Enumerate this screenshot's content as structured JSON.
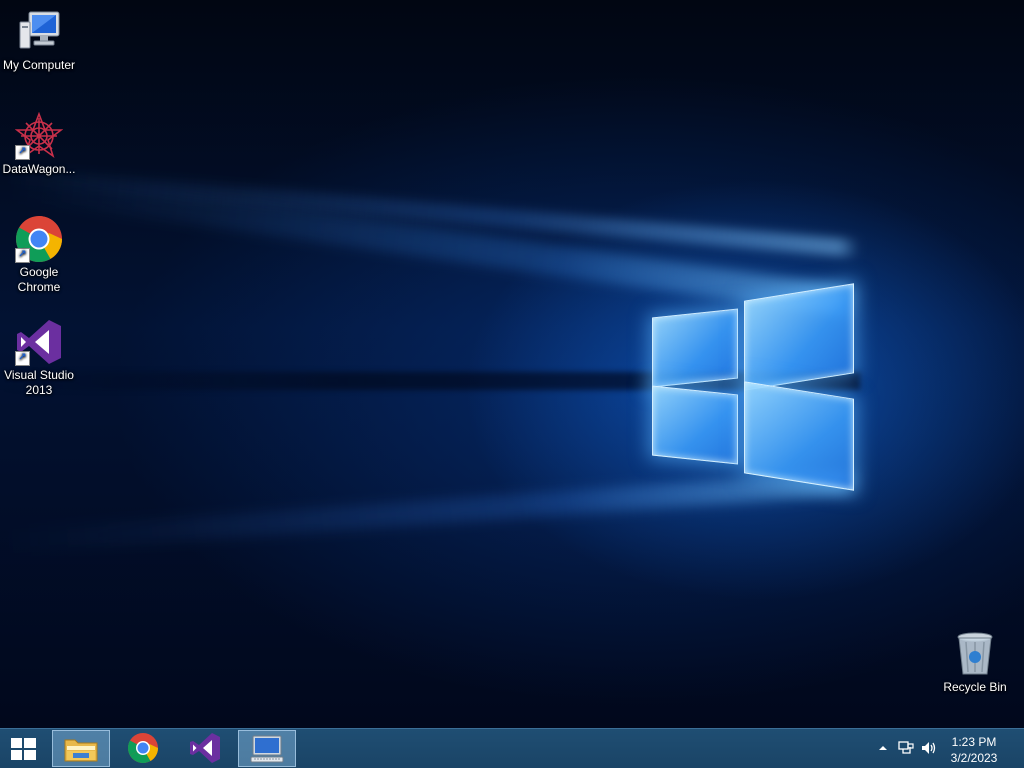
{
  "desktop_icons": [
    {
      "name": "my-computer",
      "label": "My Computer"
    },
    {
      "name": "datawagon",
      "label": "DataWagon..."
    },
    {
      "name": "google-chrome",
      "label": "Google Chrome"
    },
    {
      "name": "visual-studio",
      "label": "Visual Studio 2013"
    }
  ],
  "recycle_bin": {
    "label": "Recycle Bin"
  },
  "taskbar": {
    "start_icon": "windows-logo-icon",
    "pinned": [
      {
        "name": "file-explorer",
        "icon": "folder-icon",
        "active": true
      },
      {
        "name": "google-chrome",
        "icon": "chrome-icon",
        "active": false
      },
      {
        "name": "visual-studio",
        "icon": "visual-studio-icon",
        "active": false
      },
      {
        "name": "remote-desktop",
        "icon": "monitor-keyboard-icon",
        "active": true
      }
    ],
    "tray": {
      "time": "1:23 PM",
      "date": "3/2/2023"
    }
  },
  "colors": {
    "taskbar": "#1f4e73",
    "desktop_bg": "#021233",
    "logo_glow": "#3ca0ff"
  }
}
